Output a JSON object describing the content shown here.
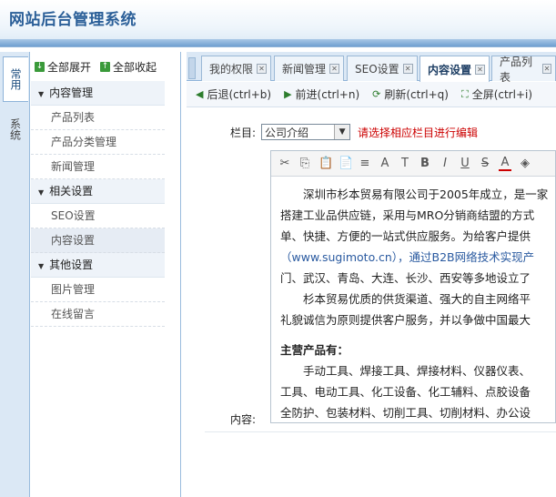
{
  "header": {
    "title": "网站后台管理系统"
  },
  "vtabs": [
    {
      "label": "常用"
    },
    {
      "label": "系统"
    }
  ],
  "menu": {
    "expand_all": "全部展开",
    "collapse_all": "全部收起",
    "groups": [
      {
        "title": "内容管理",
        "items": [
          "产品列表",
          "产品分类管理",
          "新闻管理"
        ]
      },
      {
        "title": "相关设置",
        "items": [
          "SEO设置",
          "内容设置"
        ]
      },
      {
        "title": "其他设置",
        "items": [
          "图片管理",
          "在线留言"
        ]
      }
    ]
  },
  "tabs": [
    "我的权限",
    "新闻管理",
    "SEO设置",
    "内容设置",
    "产品列表"
  ],
  "toolbar": {
    "back": "后退(ctrl+b)",
    "forward": "前进(ctrl+n)",
    "refresh": "刷新(ctrl+q)",
    "fullscreen": "全屏(ctrl+i)"
  },
  "form": {
    "column_label": "栏目:",
    "column_value": "公司介绍",
    "hint": "请选择相应栏目进行编辑",
    "content_label": "内容:"
  },
  "editor": {
    "lines": [
      "　　深圳市杉本贸易有限公司于2005年成立，是一家",
      "搭建工业品供应链，采用与MRO分销商结盟的方式",
      "单、快捷、方便的一站式供应服务。为给客户提供",
      "（www.sugimoto.cn），通过B2B网络技术实现产",
      "门、武汉、青岛、大连、长沙、西安等多地设立了",
      "　　杉本贸易优质的供货渠道、强大的自主网络平",
      "礼貌诚信为原则提供客户服务，并以争做中国最大"
    ],
    "heading": "主营产品有：",
    "product_lines": [
      "　　手动工具、焊接工具、焊接材料、仪器仪表、",
      "工具、电动工具、化工设备、化工辅料、点胶设备",
      "全防护、包装材料、切削工具、切削材料、办公设"
    ]
  }
}
